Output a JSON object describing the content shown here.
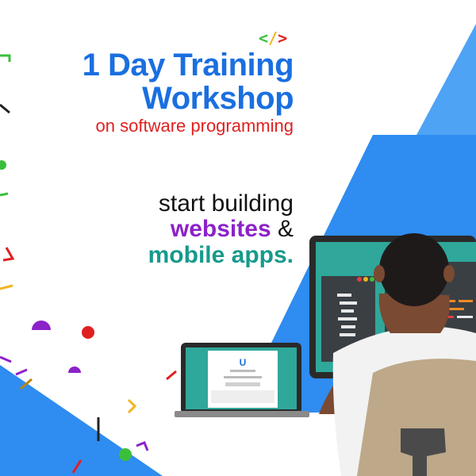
{
  "headline": {
    "line1": "1 Day Training",
    "line2": "Workshop",
    "subtitle": "on software programming"
  },
  "tagline": {
    "line1": "start building",
    "line2_word": "websites",
    "line2_amp": "&",
    "line3": "mobile apps."
  },
  "code_icon": {
    "lt": "<",
    "slash": "/",
    "gt": ">"
  },
  "illustration": {
    "laptop_logo": "U"
  },
  "colors": {
    "headline_blue": "#1a6fe0",
    "subtitle_red": "#e02020",
    "websites_purple": "#8c22c8",
    "apps_teal": "#169a8c",
    "background_blue": "#2f8cf0",
    "light_blue": "#4ea3f5",
    "monitor_teal": "#2fa79a"
  }
}
